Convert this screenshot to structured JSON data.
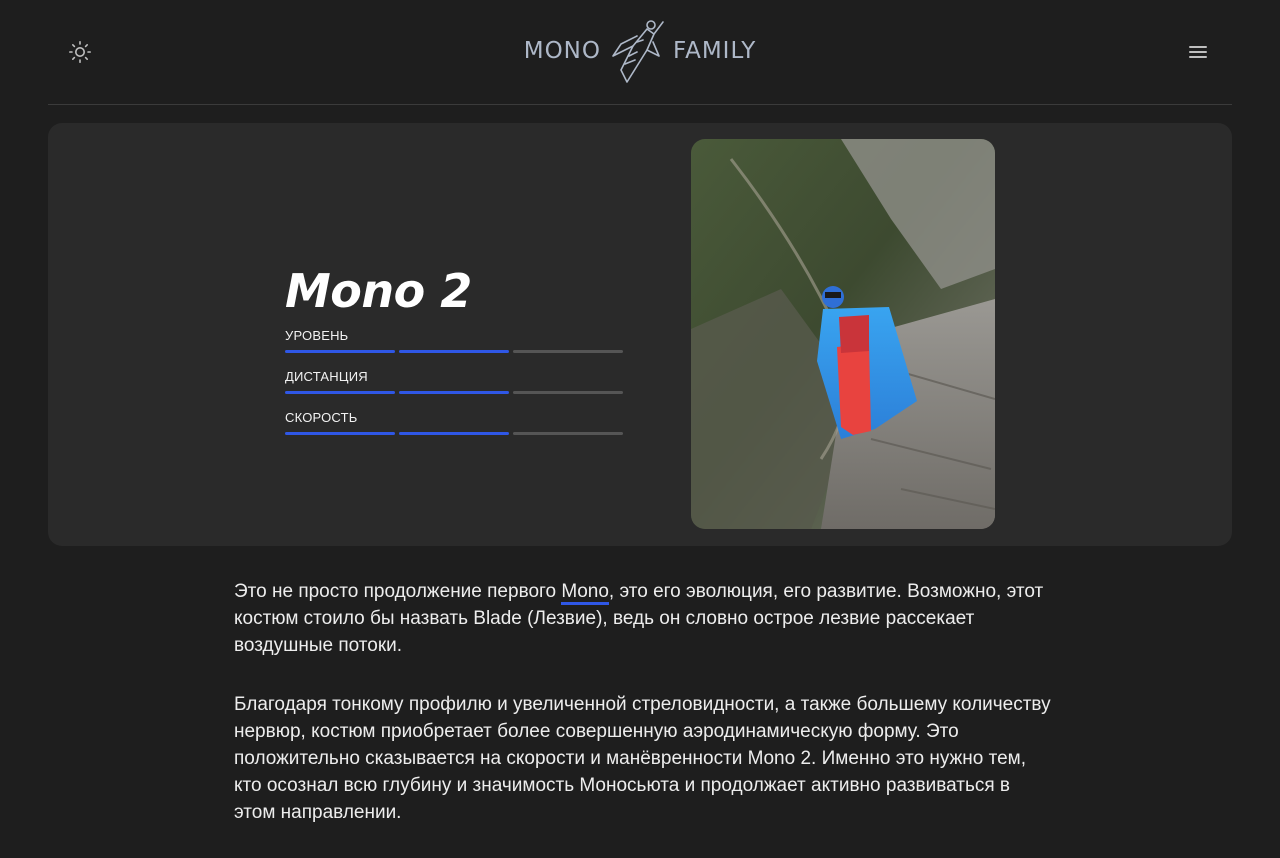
{
  "header": {
    "logo_left": "MONO",
    "logo_right": "FAMILY",
    "icons": {
      "theme": "sun-icon",
      "menu": "hamburger-menu-icon",
      "logo": "wingsuit-flyer-logo"
    }
  },
  "hero": {
    "title": "Mono 2",
    "stats": [
      {
        "label": "УРОВЕНЬ",
        "level": 2,
        "max": 3
      },
      {
        "label": "ДИСТАНЦИЯ",
        "level": 2,
        "max": 3
      },
      {
        "label": "СКОРОСТЬ",
        "level": 2,
        "max": 3
      }
    ]
  },
  "content": {
    "p1_before": "Это не просто продолжение первого ",
    "p1_link": "Mono",
    "p1_after": ", это его эволюция, его развитие. Возможно, этот костюм стоило бы назвать Blade (Лезвие), ведь он словно острое лезвие рассекает воздушные потоки.",
    "p2": "Благодаря тонкому профилю и увеличенной стреловидности, а также большему количеству нервюр, костюм приобретает более совершенную аэродинамическую форму. Это положительно сказывается на скорости и манёвренности Mono 2. Именно это нужно тем, кто осознал всю глубину и значимость Моносьюта и продолжает активно развиваться в этом направлении."
  },
  "colors": {
    "background": "#1e1e1e",
    "card": "#2a2a2a",
    "accent": "#2f57e6",
    "inactive": "#555555"
  }
}
